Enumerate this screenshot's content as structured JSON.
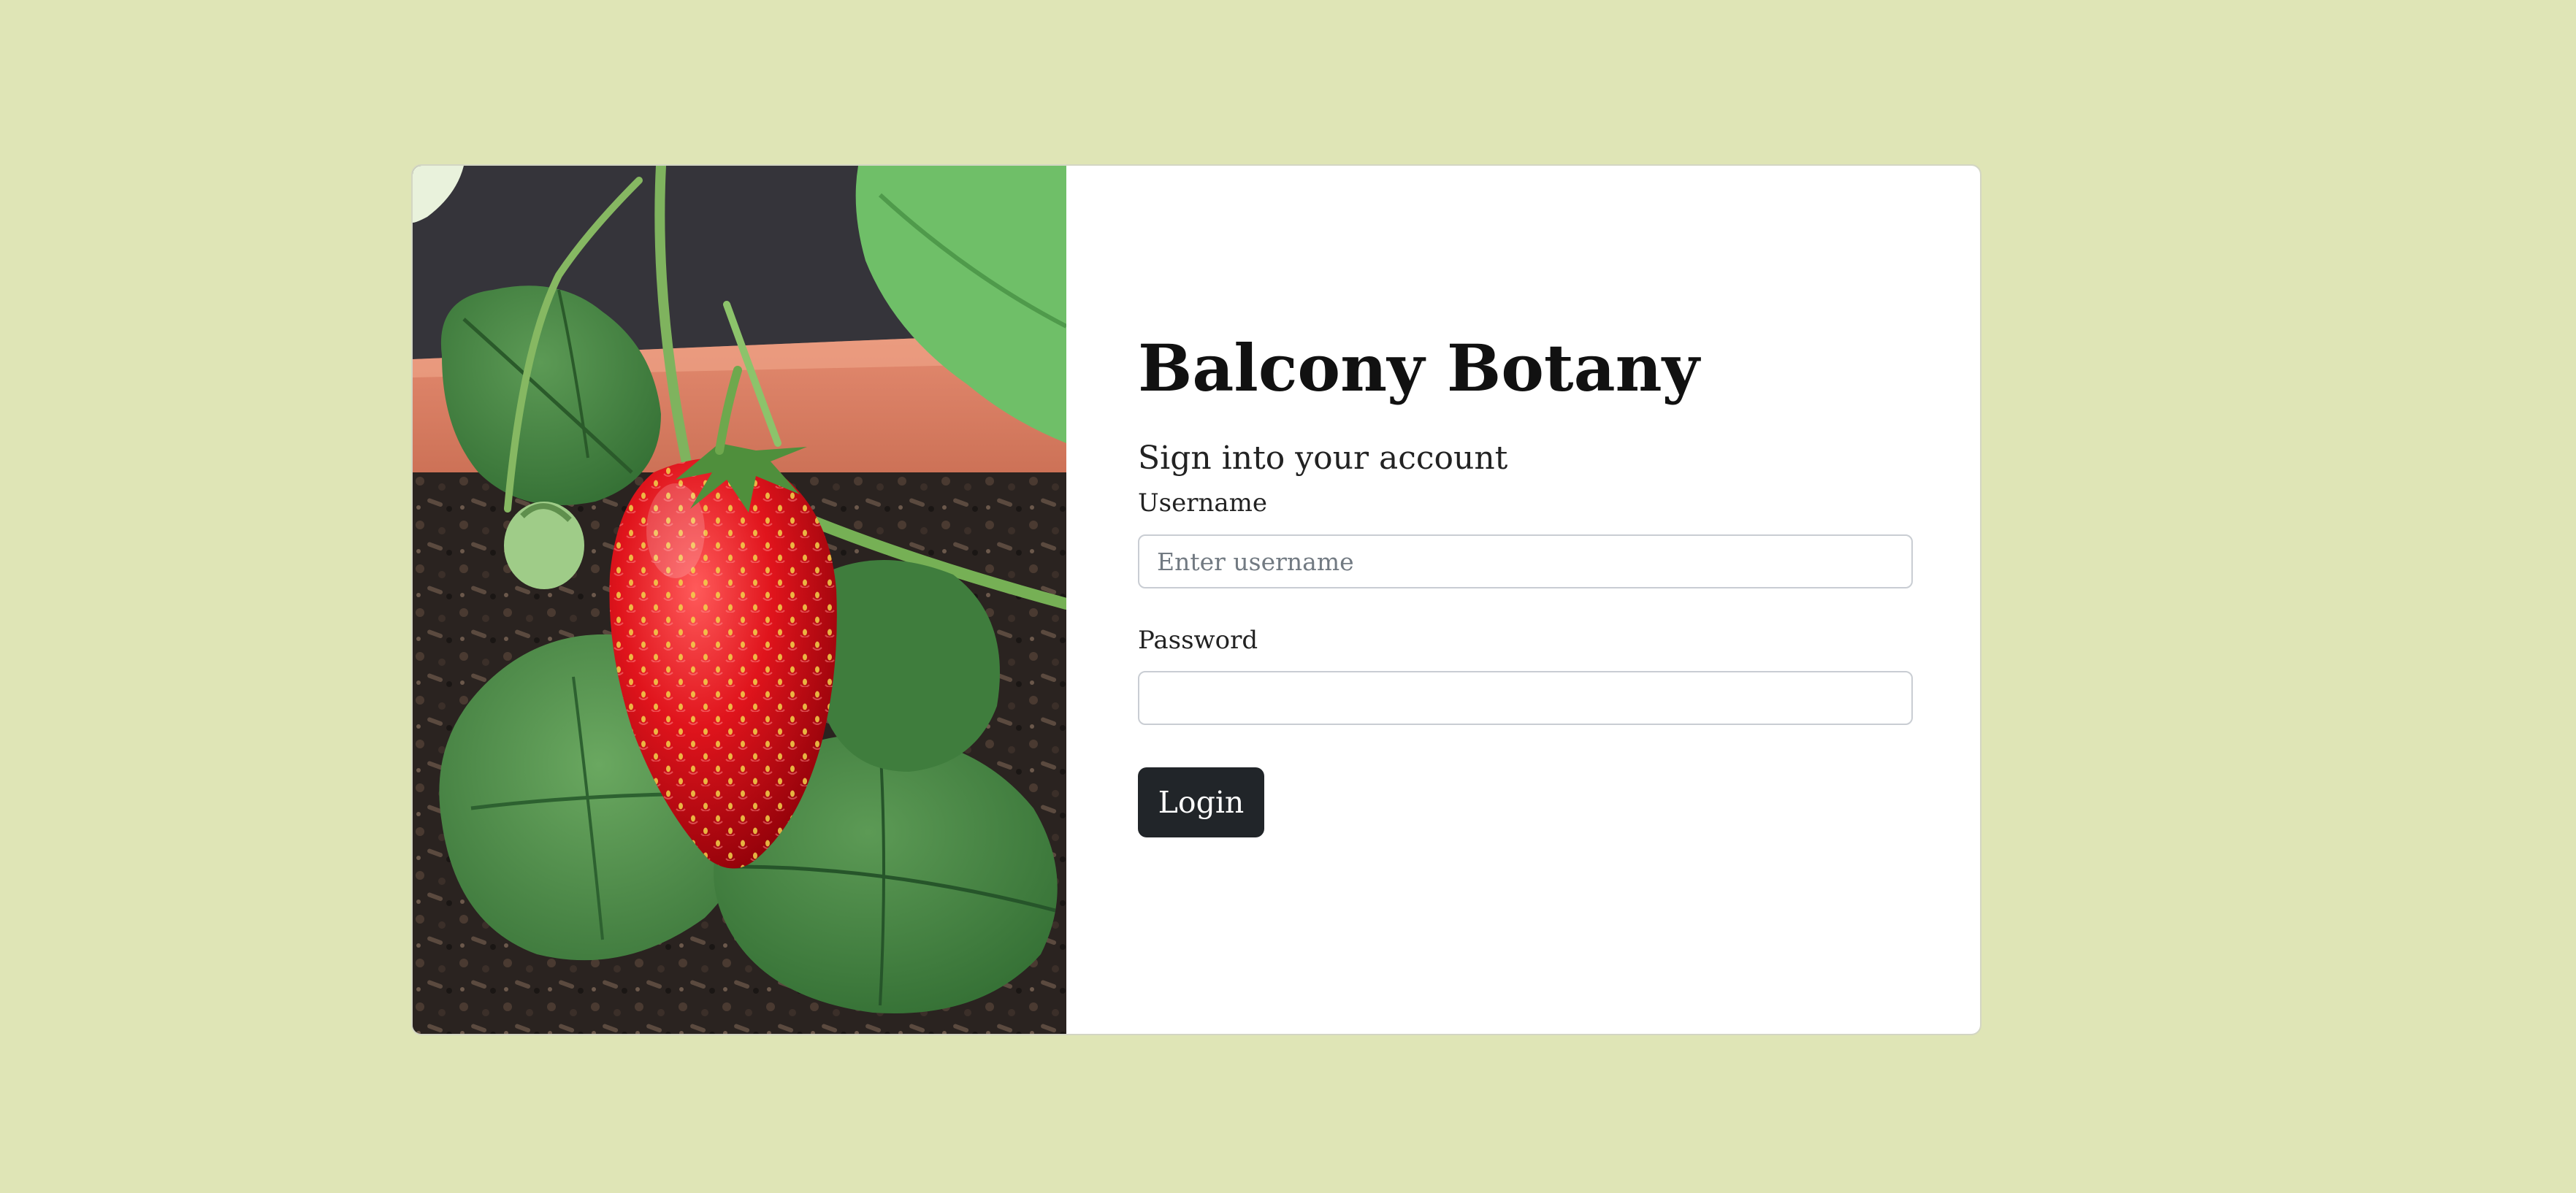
{
  "brand": {
    "title": "Balcony Botany"
  },
  "photo": {
    "subject": "strawberry-plant-photo"
  },
  "form": {
    "heading": "Sign into your account",
    "username_label": "Username",
    "username_placeholder": "Enter username",
    "username_value": "",
    "password_label": "Password",
    "password_value": "",
    "login_label": "Login"
  },
  "colors": {
    "page_background": "#dfe5b6",
    "card_background": "#ffffff",
    "button_background": "#212529",
    "button_text": "#ffffff"
  }
}
